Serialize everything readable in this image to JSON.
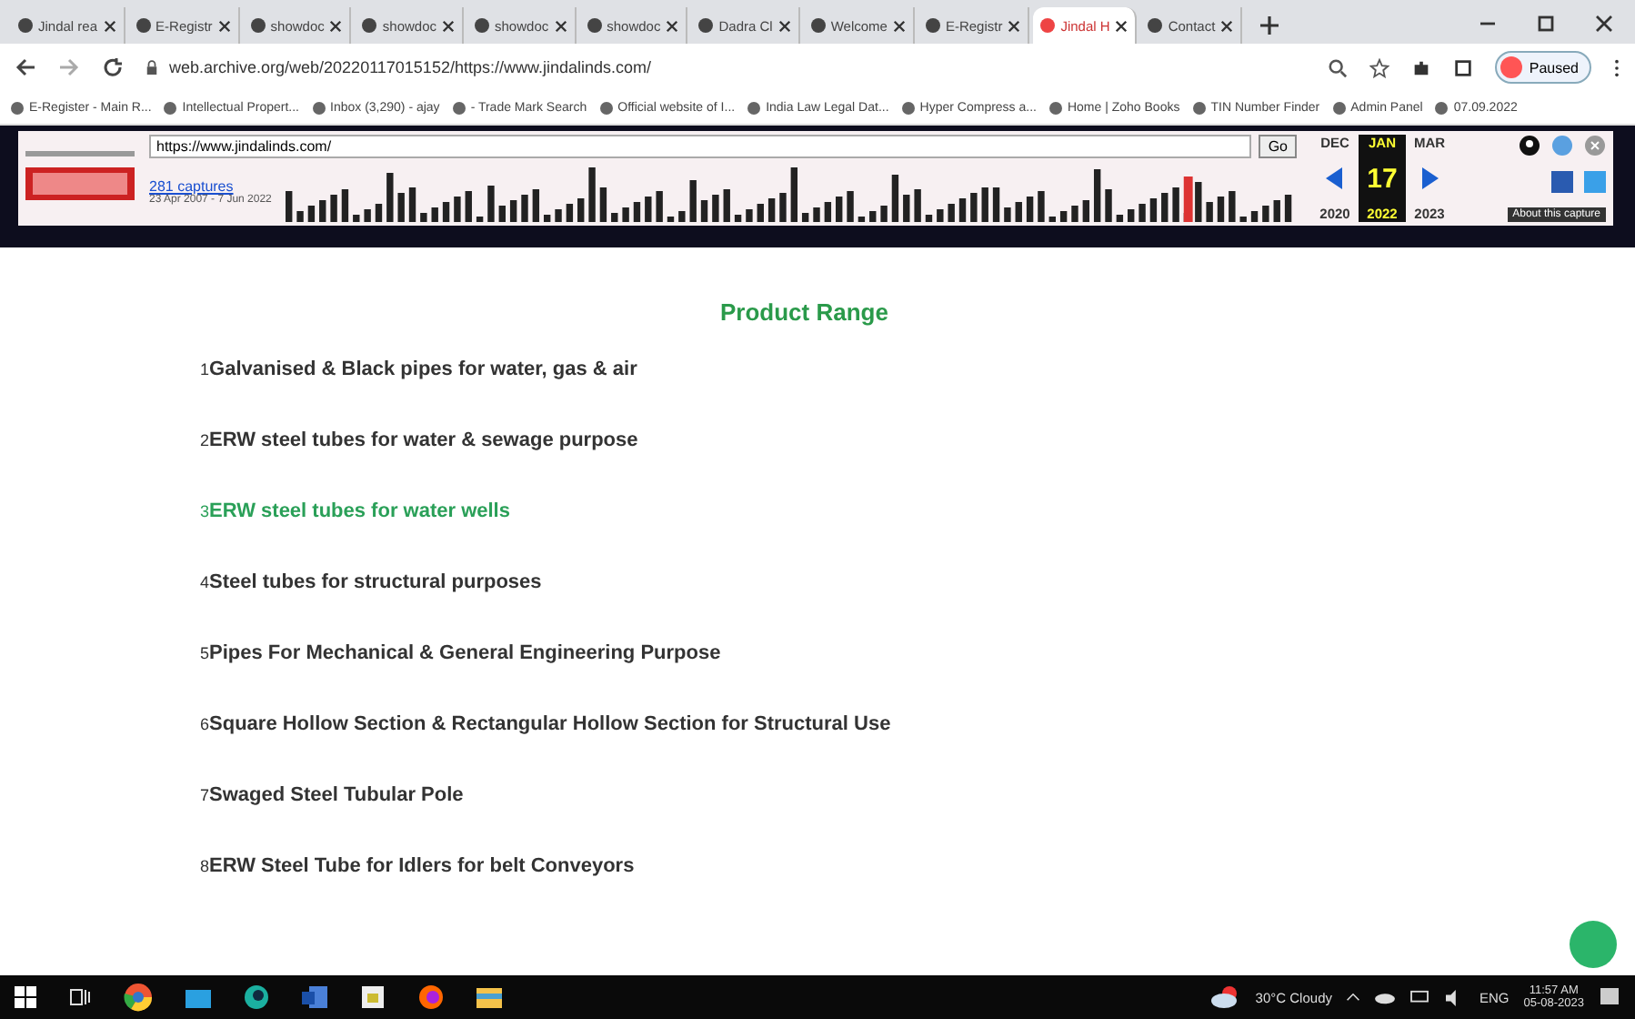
{
  "tabs": [
    {
      "label": "Jindal rea",
      "selected": false
    },
    {
      "label": "E-Registr",
      "selected": false
    },
    {
      "label": "showdoc",
      "selected": false
    },
    {
      "label": "showdoc",
      "selected": false
    },
    {
      "label": "showdoc",
      "selected": false
    },
    {
      "label": "showdoc",
      "selected": false
    },
    {
      "label": "Dadra Cl",
      "selected": false
    },
    {
      "label": "Welcome",
      "selected": false
    },
    {
      "label": "E-Registr",
      "selected": false
    },
    {
      "label": "Jindal H",
      "selected": true
    },
    {
      "label": "Contact",
      "selected": false
    }
  ],
  "address_bar": {
    "url": "web.archive.org/web/20220117015152/https://www.jindalinds.com/",
    "profile": "Paused"
  },
  "bookmarks": [
    "E-Register - Main R...",
    "Intellectual Propert...",
    "Inbox (3,290) - ajay",
    "- Trade Mark Search",
    "Official website of I...",
    "India Law Legal Dat...",
    "Hyper Compress a...",
    "Home | Zoho Books",
    "TIN Number Finder",
    "Admin Panel",
    "07.09.2022"
  ],
  "wayback": {
    "url": "https://www.jindalinds.com/",
    "go": "Go",
    "captures": "281 captures",
    "range": "23 Apr 2007 - 7 Jun 2022",
    "months": [
      "DEC",
      "JAN",
      "MAR"
    ],
    "day": "17",
    "years": [
      "2020",
      "2022",
      "2023"
    ],
    "about": "About this capture"
  },
  "page": {
    "title": "Product Range",
    "items": [
      {
        "number": "1",
        "text": "Galvanised & Black pipes for water, gas & air",
        "highlighted": false
      },
      {
        "number": "2",
        "text": "ERW steel tubes for water & sewage purpose",
        "highlighted": false
      },
      {
        "number": "3",
        "text": "ERW steel tubes for water wells",
        "highlighted": true
      },
      {
        "number": "4",
        "text": "Steel tubes for structural purposes",
        "highlighted": false
      },
      {
        "number": "5",
        "text": "Pipes For Mechanical & General Engineering Purpose",
        "highlighted": false
      },
      {
        "number": "6",
        "text": "Square Hollow Section & Rectangular Hollow Section for Structural Use",
        "highlighted": false
      },
      {
        "number": "7",
        "text": "Swaged Steel Tubular Pole",
        "highlighted": false
      },
      {
        "number": "8",
        "text": "ERW Steel Tube for Idlers for belt Conveyors",
        "highlighted": false
      }
    ]
  },
  "taskbar": {
    "weather": "30°C Cloudy",
    "language": "ENG",
    "time": "11:57 AM",
    "date": "05-08-2023"
  }
}
